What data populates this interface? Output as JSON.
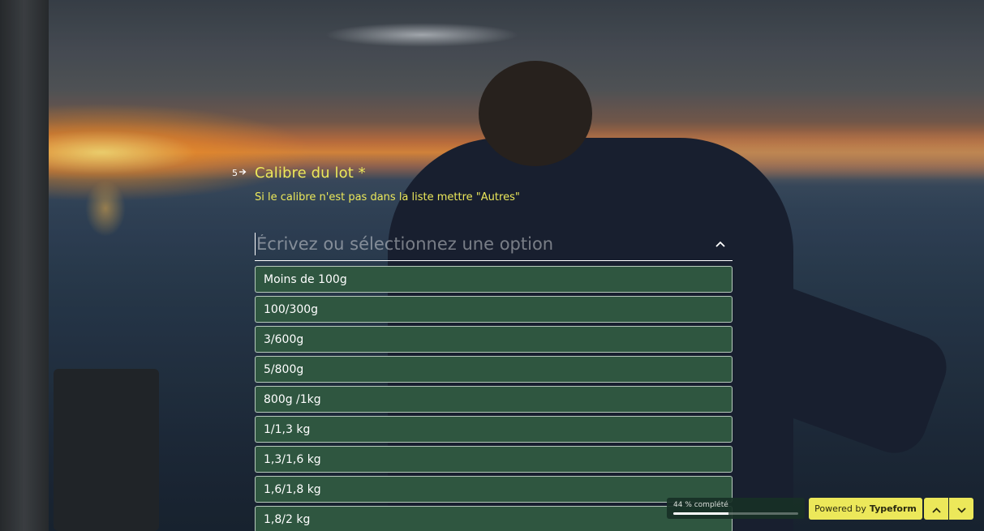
{
  "question": {
    "number": "5",
    "title": "Calibre du lot *",
    "description": "Si le calibre n'est pas dans la liste mettre \"Autres\""
  },
  "dropdown": {
    "placeholder": "Écrivez ou sélectionnez une option",
    "value": "",
    "options": [
      {
        "label": "Moins de 100g"
      },
      {
        "label": "100/300g"
      },
      {
        "label": "3/600g"
      },
      {
        "label": "5/800g"
      },
      {
        "label": "800g /1kg"
      },
      {
        "label": "1/1,3 kg"
      },
      {
        "label": "1,3/1,6 kg"
      },
      {
        "label": "1,6/1,8 kg"
      },
      {
        "label": "1,8/2 kg"
      }
    ]
  },
  "footer": {
    "progress_label": "44 % complété",
    "progress_percent": 44,
    "powered_prefix": "Powered by",
    "powered_brand": "Typeform"
  },
  "icons": {
    "collapse": "chevron-up-icon",
    "question_arrow": "arrow-right-icon",
    "nav_up": "chevron-up-icon",
    "nav_down": "chevron-down-icon"
  },
  "colors": {
    "accent": "#ece85a",
    "option_bg": "#2f5640",
    "text": "#ffffff"
  }
}
